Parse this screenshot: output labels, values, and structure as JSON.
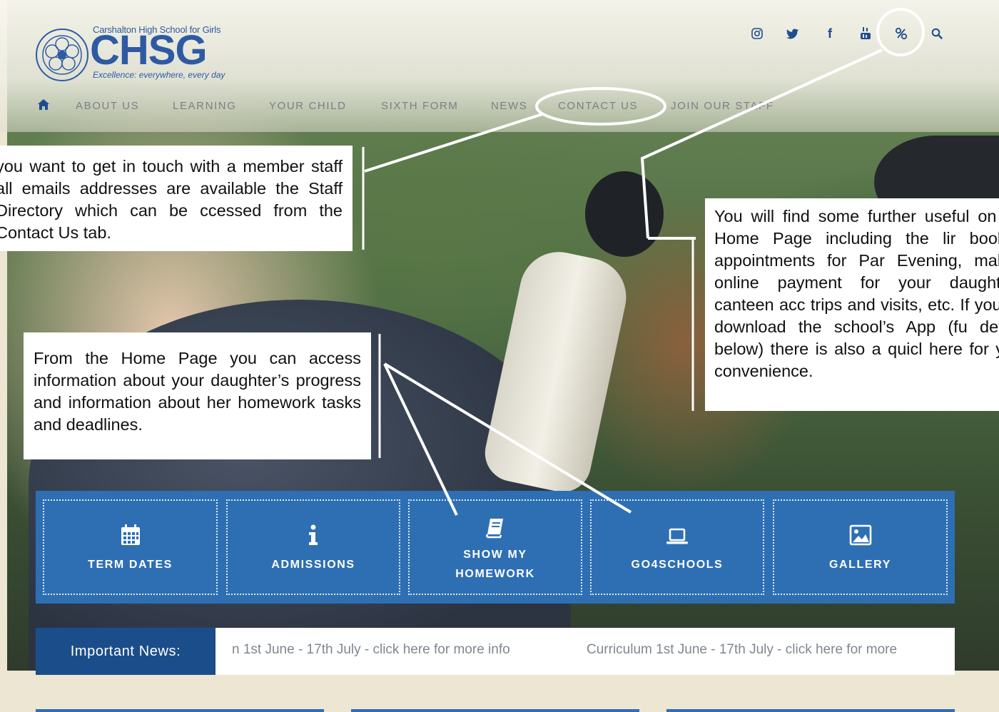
{
  "logo": {
    "top_text": "Carshalton High School for Girls",
    "main_text": "CHSG",
    "tagline": "Excellence: everywhere, every day"
  },
  "social": [
    {
      "icon": "instagram-icon",
      "glyph": "◎"
    },
    {
      "icon": "twitter-icon",
      "glyph": "✦"
    },
    {
      "icon": "facebook-icon",
      "glyph": "f"
    },
    {
      "icon": "youtube-icon",
      "glyph": "▣"
    },
    {
      "icon": "quicklinks-icon",
      "glyph": "%"
    },
    {
      "icon": "search-icon",
      "glyph": ""
    }
  ],
  "nav": {
    "items": [
      {
        "label": "ABOUT US"
      },
      {
        "label": "LEARNING"
      },
      {
        "label": "YOUR CHILD"
      },
      {
        "label": "SIXTH FORM"
      },
      {
        "label": "NEWS"
      },
      {
        "label": "CONTACT US"
      },
      {
        "label": "JOIN OUR STAFF"
      }
    ]
  },
  "callouts": {
    "contact": "you want to get in touch with a member staff all emails addresses are available the Staff Directory which can be ccessed from the Contact Us tab.",
    "home": "From the Home Page you can access information about your daughter’s progress and information about her homework tasks and deadlines.",
    "links": "You will find some further useful on the Home Page including the lir booking appointments for Par Evening, making online payment for your daughter’s canteen acc trips and visits, etc. If you wa download the school’s App (fu details below) there is also a quicl here for your convenience."
  },
  "tiles": [
    {
      "label": "TERM DATES",
      "icon": "calendar-icon"
    },
    {
      "label": "ADMISSIONS",
      "icon": "info-icon"
    },
    {
      "label": "SHOW MY HOMEWORK",
      "icon": "book-icon"
    },
    {
      "label": "GO4SCHOOLS",
      "icon": "laptop-icon"
    },
    {
      "label": "GALLERY",
      "icon": "image-icon"
    }
  ],
  "news": {
    "label": "Important News:",
    "item1": "n 1st June - 17th July - click here for more info",
    "item2": "Curriculum 1st June - 17th July - click here for more"
  },
  "colors": {
    "brand_blue": "#2e6fb4",
    "dark_blue": "#1b4d8a",
    "logo_blue": "#2f5aa3"
  }
}
